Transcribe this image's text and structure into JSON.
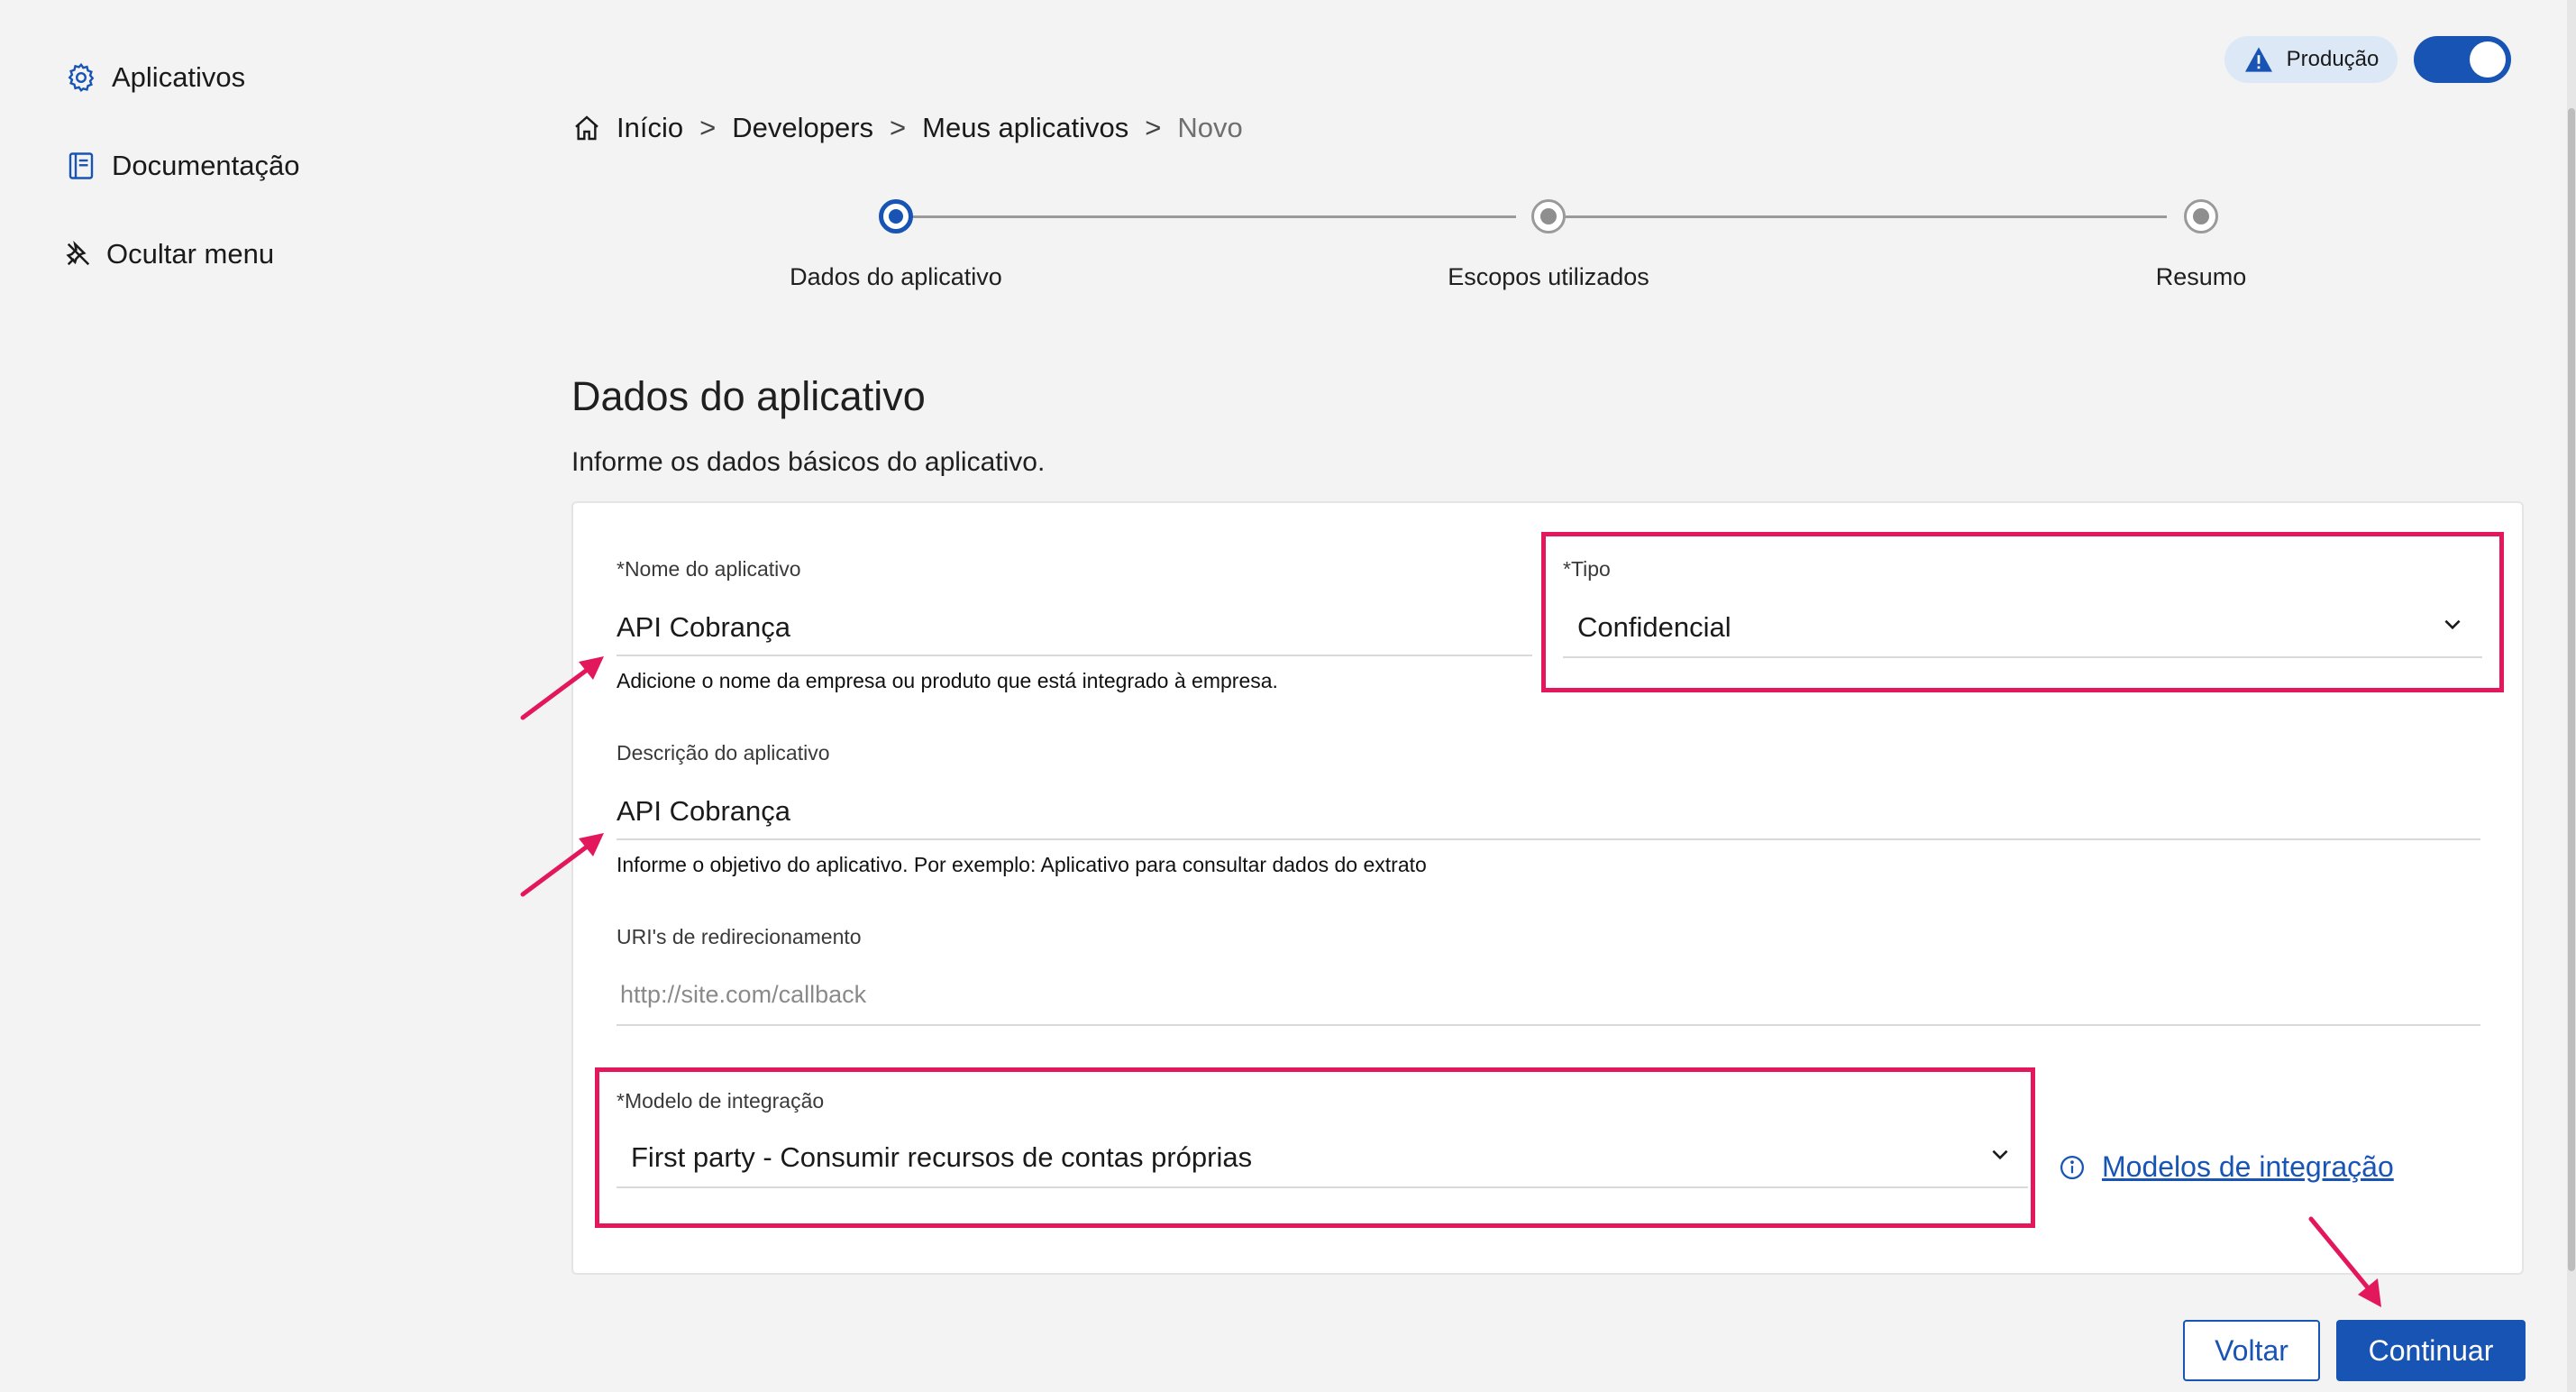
{
  "sidebar": {
    "items": [
      {
        "label": "Aplicativos",
        "icon": "gear-icon"
      },
      {
        "label": "Documentação",
        "icon": "book-icon"
      },
      {
        "label": "Ocultar menu",
        "icon": "unpin-icon"
      }
    ]
  },
  "environment": {
    "badge_label": "Produção",
    "badge_icon": "warning-icon",
    "toggle_on": true
  },
  "breadcrumb": {
    "items": [
      "Início",
      "Developers",
      "Meus aplicativos"
    ],
    "current": "Novo",
    "separator": ">"
  },
  "stepper": {
    "steps": [
      {
        "label": "Dados do aplicativo",
        "state": "active"
      },
      {
        "label": "Escopos utilizados",
        "state": "inactive"
      },
      {
        "label": "Resumo",
        "state": "inactive"
      }
    ]
  },
  "page": {
    "title": "Dados do aplicativo",
    "subtitle": "Informe os dados básicos do aplicativo."
  },
  "form": {
    "name": {
      "label": "*Nome do aplicativo",
      "value": "API Cobrança",
      "help": "Adicione o nome da empresa ou produto que está integrado à empresa."
    },
    "type": {
      "label": "*Tipo",
      "value": "Confidencial"
    },
    "description": {
      "label": "Descrição do aplicativo",
      "value": "API Cobrança",
      "help": "Informe o objetivo do aplicativo. Por exemplo: Aplicativo para consultar dados do extrato"
    },
    "redirect": {
      "label": "URI's de redirecionamento",
      "placeholder": "http://site.com/callback"
    },
    "integration_model": {
      "label": "*Modelo de integração",
      "value": "First party - Consumir recursos de contas próprias"
    }
  },
  "integration_link": {
    "label": "Modelos de integração",
    "icon": "info-icon"
  },
  "buttons": {
    "back": "Voltar",
    "continue": "Continuar"
  },
  "colors": {
    "primary": "#1854b4",
    "annotation": "#e3185c",
    "background": "#f3f3f3"
  }
}
